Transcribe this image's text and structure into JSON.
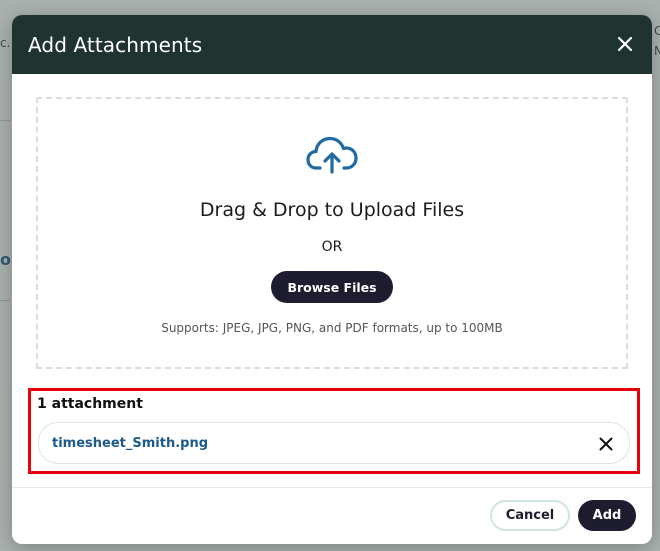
{
  "background": {
    "frag_left_top": "c.",
    "frag_right_top1": "C",
    "frag_right_top2": "N",
    "frag_left_mid": "o)"
  },
  "modal": {
    "title": "Add Attachments",
    "close_icon": "close-icon"
  },
  "dropzone": {
    "icon": "cloud-upload-icon",
    "title": "Drag & Drop to Upload Files",
    "or_text": "OR",
    "browse_label": "Browse Files",
    "supports_text": "Supports: JPEG, JPG, PNG, and PDF formats, up to 100MB"
  },
  "attachments": {
    "count_label": "1 attachment",
    "files": [
      {
        "name": "timesheet_Smith.png",
        "remove_icon": "close-icon"
      }
    ],
    "highlight_color": "#e8000b"
  },
  "footer": {
    "cancel_label": "Cancel",
    "add_label": "Add"
  },
  "colors": {
    "header_bg": "#1f3330",
    "primary_button": "#1e1d2f",
    "file_link": "#1d5a8c",
    "icon_accent": "#1f6aa5"
  }
}
